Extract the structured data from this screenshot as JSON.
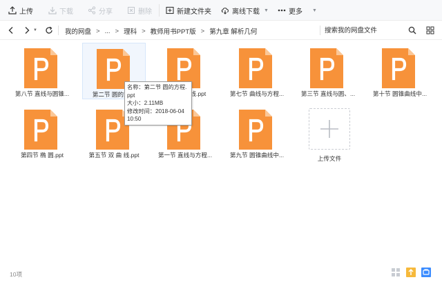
{
  "toolbar": {
    "upload": "上传",
    "download": "下载",
    "share": "分享",
    "delete": "删除",
    "new_folder": "新建文件夹",
    "offline_download": "离线下载",
    "more": "更多"
  },
  "breadcrumb": {
    "root": "我的网盘",
    "ellipsis": "...",
    "level1": "理科",
    "level2": "教师用书PPT版",
    "level3": "第九章  解析几何"
  },
  "search": {
    "placeholder": "搜索我的网盘文件"
  },
  "files": [
    {
      "name": "第八节  直线与圆锥..."
    },
    {
      "name": "第二节  圆的方程"
    },
    {
      "name": "第六节 ... 线.ppt"
    },
    {
      "name": "第七节  曲线与方程..."
    },
    {
      "name": "第三节  直线与圆、..."
    },
    {
      "name": "第十节  圆锥曲线中..."
    },
    {
      "name": "第四节   椭    圆.ppt"
    },
    {
      "name": "第五节  双 曲 线.ppt"
    },
    {
      "name": "第一节  直线与方程..."
    },
    {
      "name": "第九节  圆锥曲线中..."
    }
  ],
  "upload_tile": {
    "label": "上传文件"
  },
  "tooltip": {
    "name_line1": "名称：第二节  圆的方程.",
    "name_line2": "ppt",
    "size": "大小：2.11MB",
    "modified_line1": "修改时间：2018-06-04",
    "modified_line2": "10:50"
  },
  "status": {
    "count": "10项"
  },
  "colors": {
    "ppt_orange": "#f7923a",
    "ppt_fold": "#fbc797",
    "accent_blue": "#3b8cff",
    "toolbar_bg": "#f7f8fa"
  },
  "icons": [
    "upload-icon",
    "download-icon",
    "share-icon",
    "delete-icon",
    "new-folder-icon",
    "cloud-download-icon",
    "more-icon",
    "back-icon",
    "forward-icon",
    "refresh-icon",
    "search-icon",
    "grid-view-icon",
    "ppt-file-icon",
    "plus-icon"
  ]
}
